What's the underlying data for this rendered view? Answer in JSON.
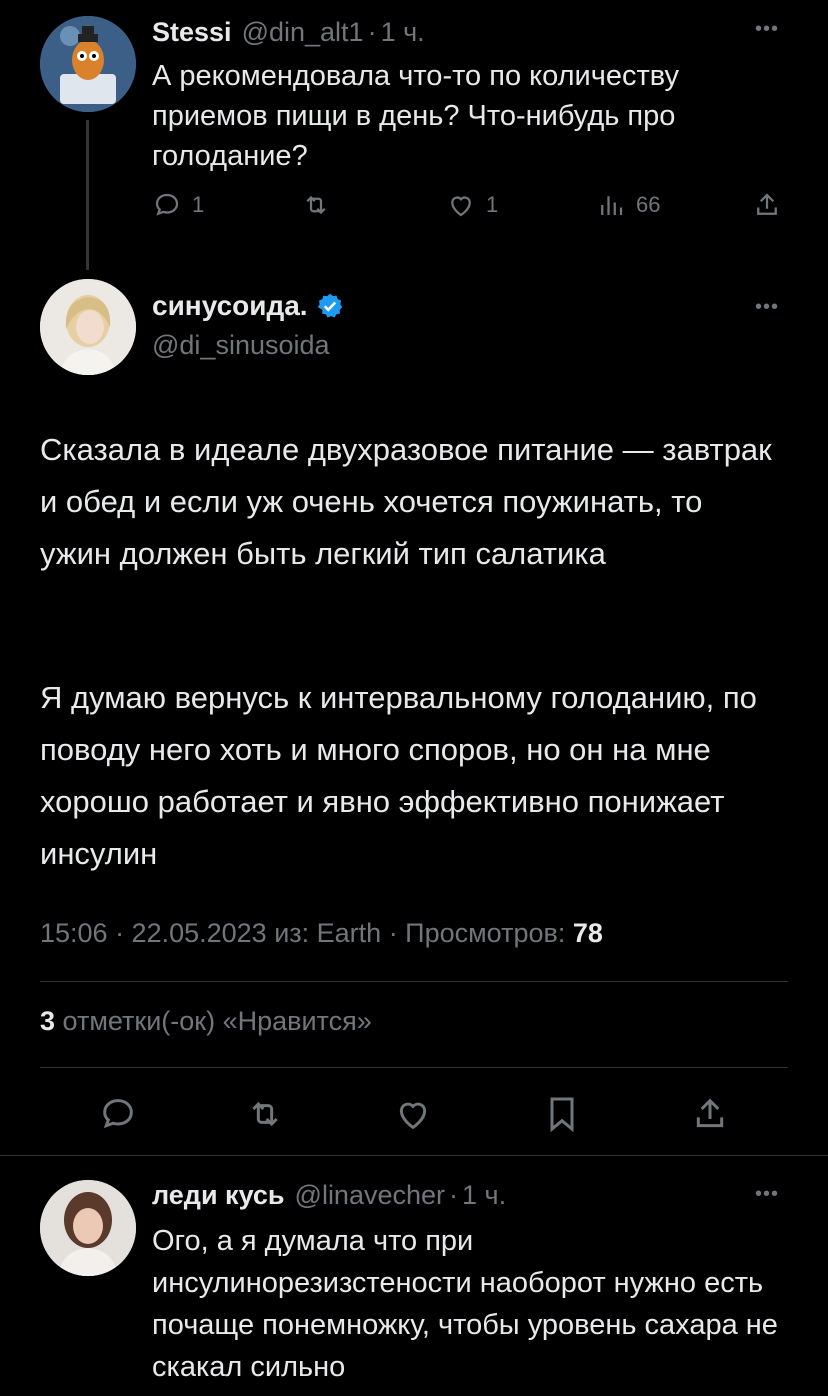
{
  "reply_parent": {
    "display_name": "Stessi",
    "handle": "@din_alt1",
    "separator": "·",
    "time": "1 ч.",
    "text": "А рекомендовала что-то по количеству приемов пищи в день? Что-нибудь про голодание?",
    "replies": "1",
    "likes": "1",
    "views": "66"
  },
  "main_tweet": {
    "display_name": "синусоида.",
    "handle": "@di_sinusoida",
    "verified": true,
    "paragraph_1": "Сказала в идеале двухразовое питание — завтрак и обед и если уж очень хочется поужинать, то ужин должен быть легкий тип салатика",
    "paragraph_2": "Я думаю вернусь к интервальному голоданию, по поводу него хоть и много споров, но он на мне хорошо работает и явно эффективно понижает инсулин",
    "timestamp": "15:06 · 22.05.2023 из: Earth · Просмотров:",
    "views": "78",
    "likes_count": "3",
    "likes_label": "отметки(-ок) «Нравится»"
  },
  "reply": {
    "display_name": "леди кусь",
    "handle": "@linavecher",
    "separator": "·",
    "time": "1 ч.",
    "text": "Ого, а я думала что при инсулинорезизстености наоборот нужно есть почаще понемножку, чтобы уровень сахара не скакал сильно"
  },
  "icons": {
    "reply": "reply-icon",
    "retweet": "retweet-icon",
    "like": "heart-icon",
    "views": "views-icon",
    "share": "share-icon",
    "bookmark": "bookmark-icon",
    "more": "more-icon",
    "verified": "verified-badge-icon"
  },
  "colors": {
    "background": "#000000",
    "text": "#e7e9ea",
    "muted": "#71767b",
    "verified": "#1d9bf0",
    "divider": "#2f3336"
  }
}
